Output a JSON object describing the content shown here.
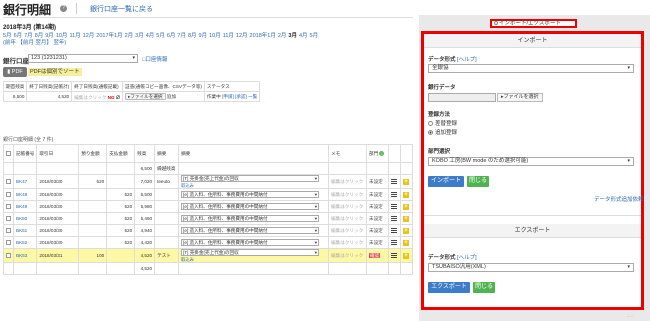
{
  "header": {
    "title": "銀行明細",
    "back_link": "銀行口座一覧に戻る"
  },
  "period": {
    "title": "2018年3月 (第14期)",
    "months": [
      {
        "label": "5月",
        "current": false
      },
      {
        "label": "6月",
        "current": false
      },
      {
        "label": "7月",
        "current": false
      },
      {
        "label": "8月",
        "current": false
      },
      {
        "label": "9月",
        "current": false
      },
      {
        "label": "10月",
        "current": false
      },
      {
        "label": "11月",
        "current": false
      },
      {
        "label": "12月",
        "current": false
      },
      {
        "label": "2017年1月",
        "current": false
      },
      {
        "label": "2月",
        "current": false
      },
      {
        "label": "3月",
        "current": false
      },
      {
        "label": "4月",
        "current": false
      },
      {
        "label": "5月",
        "current": false
      },
      {
        "label": "6月",
        "current": false
      },
      {
        "label": "7月",
        "current": false
      },
      {
        "label": "8月",
        "current": false
      },
      {
        "label": "9月",
        "current": false
      },
      {
        "label": "10月",
        "current": false
      },
      {
        "label": "11月",
        "current": false
      },
      {
        "label": "12月",
        "current": false
      },
      {
        "label": "2018年1月",
        "current": false
      },
      {
        "label": "2月",
        "current": false
      },
      {
        "label": "3月",
        "current": true
      },
      {
        "label": "4月",
        "current": false
      },
      {
        "label": "5月",
        "current": false
      }
    ],
    "aux_links": "(前年 【前月 翌月】 翌年)"
  },
  "account": {
    "label": "銀行口座",
    "selected": "123 (1231231)",
    "info_link": "口座情報",
    "pdf_button": "PDF",
    "pdf_hint": "PDFは個別でソート"
  },
  "balance_table": {
    "headers": [
      "期首残高",
      "終了日残高(記帳計)",
      "終了日残高(通帳記載)",
      "証憑(通帳コピー画像、CSVデータ等)",
      "ステータス"
    ],
    "opening": "6,500",
    "closing_book": "4,520",
    "closing_passbook_ph": "編集はクリック",
    "ng": "NG",
    "file_button": "ファイルを選択",
    "add_button": "追加",
    "status": "作業中",
    "status_links": [
      "申請",
      "承認",
      "一覧"
    ]
  },
  "detail": {
    "caption": "銀行口座明細 (全 7 件)",
    "headers": [
      "",
      "記帳番号",
      "取引日",
      "預り金額",
      "支払金額",
      "残高",
      "摘要",
      "摘要",
      "メモ",
      "部門",
      "",
      ""
    ],
    "opening_row": {
      "balance": "6,500",
      "label": "繰越残高"
    },
    "rows": [
      {
        "id": "BK47",
        "date": "2018/03/30",
        "deposit": "520",
        "payment": "",
        "balance": "7,020",
        "summary": "teeuto",
        "account": "[T] 売掛金(売上代金)の回収",
        "link": "取込み",
        "memo": "編集はクリック",
        "dept": "未設定",
        "highlight": false,
        "dept_red": false
      },
      {
        "id": "BK48",
        "date": "2018/03/30",
        "deposit": "",
        "payment": "520",
        "balance": "6,500",
        "summary": "",
        "account": "[e] 造入料、住所料、事務費用の中間納付",
        "link": "",
        "memo": "編集はクリック",
        "dept": "未設定",
        "highlight": false,
        "dept_red": false
      },
      {
        "id": "BK49",
        "date": "2018/03/30",
        "deposit": "",
        "payment": "520",
        "balance": "5,980",
        "summary": "",
        "account": "[e] 造入料、住所料、事務費用の中間納付",
        "link": "",
        "memo": "編集はクリック",
        "dept": "未設定",
        "highlight": false,
        "dept_red": false
      },
      {
        "id": "BK50",
        "date": "2018/03/30",
        "deposit": "",
        "payment": "520",
        "balance": "5,460",
        "summary": "",
        "account": "[e] 造入料、住所料、事務費用の中間納付",
        "link": "",
        "memo": "編集はクリック",
        "dept": "未設定",
        "highlight": false,
        "dept_red": false
      },
      {
        "id": "BK51",
        "date": "2018/03/30",
        "deposit": "",
        "payment": "520",
        "balance": "4,940",
        "summary": "",
        "account": "[e] 造入料、住所料、事務費用の中間納付",
        "link": "",
        "memo": "編集はクリック",
        "dept": "未設定",
        "highlight": false,
        "dept_red": false
      },
      {
        "id": "BK52",
        "date": "2018/03/30",
        "deposit": "",
        "payment": "520",
        "balance": "4,420",
        "summary": "",
        "account": "[e] 造入料、住所料、事務費用の中間納付",
        "link": "",
        "memo": "編集はクリック",
        "dept": "未設定",
        "highlight": false,
        "dept_red": false
      },
      {
        "id": "BK53",
        "date": "2018/03/31",
        "deposit": "100",
        "payment": "",
        "balance": "4,520",
        "summary": "テスト",
        "account": "[T] 売掛金(売上代金)の回収",
        "link": "取込み",
        "memo": "編集はクリック",
        "dept": "確認",
        "highlight": true,
        "dept_red": true
      }
    ],
    "closing_balance": "4,520"
  },
  "panel": {
    "tab_label": "インポート/エクスポート",
    "import": {
      "heading": "インポート",
      "format_label": "データ形式",
      "help": "[ヘルプ]",
      "format_value": "全銀協",
      "data_label": "銀行データ",
      "file_button": "ファイルを選択",
      "method_label": "登録方法",
      "method_options": [
        {
          "label": "差替登録",
          "checked": false
        },
        {
          "label": "追加登録",
          "checked": true
        }
      ],
      "dept_label": "部門選択",
      "dept_value": "KOBO 工房(BW mode のため選択可能)",
      "import_button": "インポート",
      "close_button": "閉じる",
      "add_format_link": "データ形式追加依頼"
    },
    "export": {
      "heading": "エクスポート",
      "format_label": "データ形式",
      "help": "[ヘルプ]",
      "format_value": "TSUBAISO汎用(XML)",
      "export_button": "エクスポート",
      "close_button": "閉じる"
    }
  },
  "colors": {
    "accent_blue": "#3d7cc9",
    "accent_green": "#4fb34f",
    "highlight_red": "#e00000",
    "row_highlight": "#fcf8a4"
  }
}
